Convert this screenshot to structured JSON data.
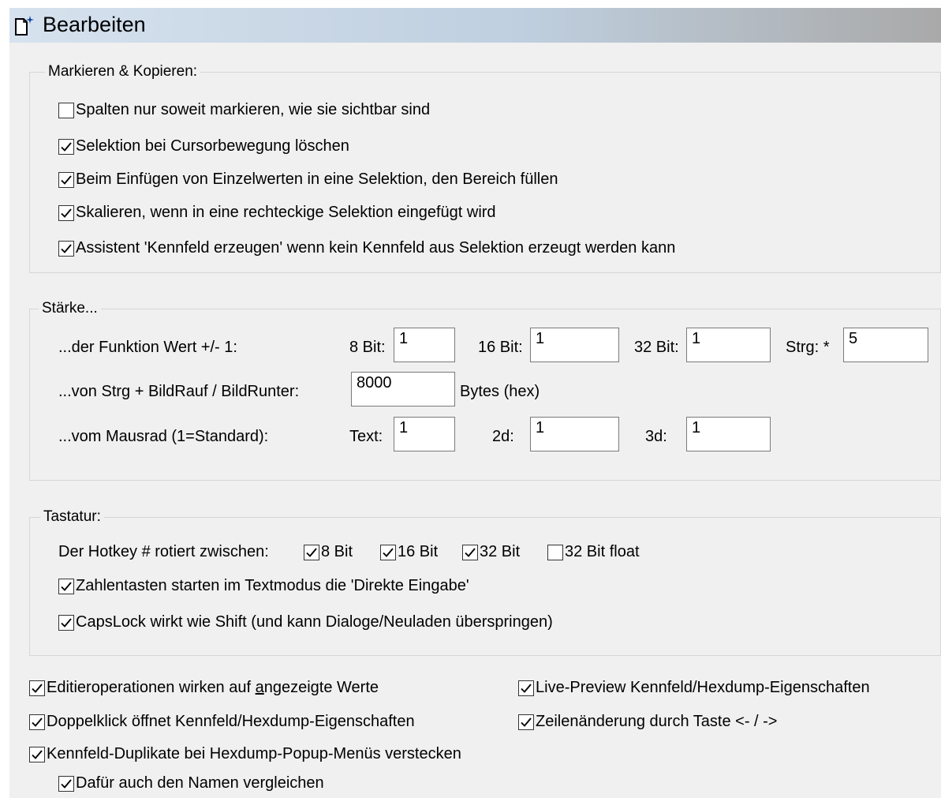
{
  "header": {
    "title": "Bearbeiten",
    "icon": "new-document-icon"
  },
  "markieren": {
    "legend": "Markieren & Kopieren:",
    "options": [
      {
        "label": "Spalten nur soweit markieren, wie sie sichtbar sind",
        "checked": false
      },
      {
        "label": "Selektion bei Cursorbewegung löschen",
        "checked": true
      },
      {
        "label": "Beim Einfügen von Einzelwerten in eine Selektion, den Bereich füllen",
        "checked": true
      },
      {
        "label": "Skalieren, wenn in eine rechteckige Selektion eingefügt wird",
        "checked": true
      },
      {
        "label": "Assistent 'Kennfeld erzeugen' wenn kein Kennfeld aus Selektion erzeugt werden kann",
        "checked": true
      }
    ]
  },
  "staerke": {
    "legend": "Stärke...",
    "row1": {
      "label": "...der Funktion Wert +/- 1:",
      "bit8_label": "8 Bit:",
      "bit8_value": "1",
      "bit16_label": "16 Bit:",
      "bit16_value": "1",
      "bit32_label": "32 Bit:",
      "bit32_value": "1",
      "strg_label": "Strg: *",
      "strg_value": "5"
    },
    "row2": {
      "label": "...von Strg + BildRauf / BildRunter:",
      "value": "8000",
      "unit": "Bytes (hex)"
    },
    "row3": {
      "label": "...vom Mausrad (1=Standard):",
      "text_label": "Text:",
      "text_value": "1",
      "d2_label": "2d:",
      "d2_value": "1",
      "d3_label": "3d:",
      "d3_value": "1"
    }
  },
  "tastatur": {
    "legend": "Tastatur:",
    "hotkey_label": "Der Hotkey # rotiert zwischen:",
    "hotkey_options": [
      {
        "label": "8 Bit",
        "checked": true
      },
      {
        "label": "16 Bit",
        "checked": true
      },
      {
        "label": "32 Bit",
        "checked": true
      },
      {
        "label": "32 Bit float",
        "checked": false
      }
    ],
    "options": [
      {
        "label": "Zahlentasten starten im Textmodus die 'Direkte Eingabe'",
        "checked": true
      },
      {
        "label": "CapsLock wirkt wie Shift (und kann Dialoge/Neuladen überspringen)",
        "checked": true
      }
    ]
  },
  "bottom": {
    "edit_ops": {
      "label_before": "Editieroperationen wirken auf ",
      "label_underlined": "a",
      "label_after": "ngezeigte Werte",
      "checked": true
    },
    "live_preview": {
      "label": "Live-Preview Kennfeld/Hexdump-Eigenschaften",
      "checked": true
    },
    "doppelklick": {
      "label": "Doppelklick öffnet Kennfeld/Hexdump-Eigenschaften",
      "checked": true
    },
    "zeilen": {
      "label": "Zeilenänderung durch Taste <- / ->",
      "checked": true
    },
    "duplikate": {
      "label": "Kennfeld-Duplikate bei Hexdump-Popup-Menüs verstecken",
      "checked": true
    },
    "namen": {
      "label": "Dafür auch den Namen vergleichen",
      "checked": true
    }
  }
}
